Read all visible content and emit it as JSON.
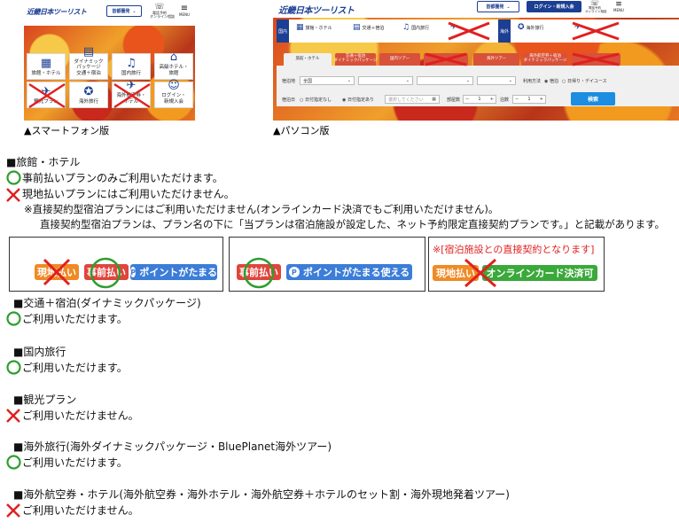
{
  "phone": {
    "logo": "近畿日本ツーリスト",
    "region_select": "首都圏発",
    "contact_label": "電話予約\nオンライン相談",
    "menu_label": "MENU",
    "tiles": [
      {
        "label": "旅館・ホテル",
        "icon": "hotel-icon",
        "crossed": false,
        "circled": false
      },
      {
        "label": "ダイナミック\nパッケージ\n交通＋宿泊",
        "icon": "dynamic-package-icon",
        "crossed": false,
        "circled": false
      },
      {
        "label": "国内旅行",
        "icon": "domestic-travel-icon",
        "crossed": false,
        "circled": false
      },
      {
        "label": "高級ホテル・\n旅館",
        "icon": "luxury-hotel-icon",
        "crossed": false,
        "circled": false
      },
      {
        "label": "観光プラン",
        "icon": "sightseeing-icon",
        "crossed": true,
        "circled": false
      },
      {
        "label": "海外旅行",
        "icon": "overseas-travel-icon",
        "crossed": false,
        "circled": false
      },
      {
        "label": "海外航空券・\nホテル",
        "icon": "overseas-flight-icon",
        "crossed": true,
        "circled": false
      },
      {
        "label": "ログイン・\n新規入会",
        "icon": "user-icon",
        "crossed": false,
        "circled": false
      }
    ],
    "caption": "▲スマートフォン版"
  },
  "pc": {
    "logo": "近畿日本ツーリスト",
    "region_select": "首都圏発",
    "login_button": "ログイン・新規入会",
    "contact_label": "電話予約\nオンライン相談",
    "menu_label": "MENU",
    "domestic_label": "国内",
    "overseas_label": "海外",
    "nav": [
      "旅館・ホテル",
      "交通＋宿泊",
      "国内旅行",
      "海外旅行"
    ],
    "tabs": [
      {
        "label": "旅館・ホテル",
        "active": true
      },
      {
        "label": "交通＋宿泊\nダイナミックパッケージ",
        "active": false
      },
      {
        "label": "国内ツアー",
        "active": false
      },
      {
        "label": "",
        "active": false
      },
      {
        "label": "海外ツアー",
        "active": false
      },
      {
        "label": "海外航空券＋宿泊\nダイナミックパッケージ",
        "active": false
      },
      {
        "label": "",
        "active": false
      }
    ],
    "form": {
      "destination_label": "宿泊地",
      "destination_value": "全国",
      "usage_label": "利用方法",
      "usage_options": [
        "宿泊",
        "日帰り・デイユース"
      ],
      "date_label": "宿泊日",
      "date_options": [
        "日付指定なし",
        "日付指定あり"
      ],
      "date_placeholder": "選択してください",
      "rooms_label": "部屋数",
      "rooms_value": "1",
      "nights_label": "泊数",
      "nights_value": "1",
      "search_button": "検索"
    },
    "caption": "▲パソコン版"
  },
  "sections": {
    "hotel": {
      "heading": "■旅館・ホテル",
      "ok_line": "事前払いプランのみご利用いただけます。",
      "ng_line": "現地払いプランにはご利用いただけません。",
      "note1": "※直接契約型宿泊プランにはご利用いただけません(オンラインカード決済でもご利用いただけません)。",
      "note2": "直接契約型宿泊プランは、プラン名の下に「当プランは宿泊施設が設定した、ネット予約限定直接契約プランです。」と記載があります。"
    },
    "examples": {
      "box1": {
        "pay_local": "現地払い",
        "pay_advance": "事前払い",
        "points": "ポイントがたまる"
      },
      "box2": {
        "pay_advance": "事前払い",
        "points": "ポイントがたまる使える"
      },
      "box3": {
        "note": "※[宿泊施設との直接契約となります]",
        "pay_local": "現地払い",
        "online_card": "オンラインカード決済可"
      }
    },
    "dp": {
      "heading": "■交通＋宿泊(ダイナミックパッケージ)",
      "line": "ご利用いただけます。",
      "ok": true
    },
    "domestic": {
      "heading": "■国内旅行",
      "line": "ご利用いただけます。",
      "ok": true
    },
    "sightseeing": {
      "heading": "■観光プラン",
      "line": "ご利用いただけません。",
      "ok": false
    },
    "overseas": {
      "heading": "■海外旅行(海外ダイナミックパッケージ・BluePlanet海外ツアー)",
      "line": "ご利用いただけます。",
      "ok": true
    },
    "overseas_flight": {
      "heading": "■海外航空券・ホテル(海外航空券・海外ホテル・海外航空券＋ホテルのセット割・海外現地発着ツアー)",
      "line": "ご利用いただけません。",
      "ok": false
    }
  },
  "colors": {
    "brand": "#1c3f94",
    "ok_circle": "#2e9e2e",
    "ng_cross": "#e02020"
  }
}
